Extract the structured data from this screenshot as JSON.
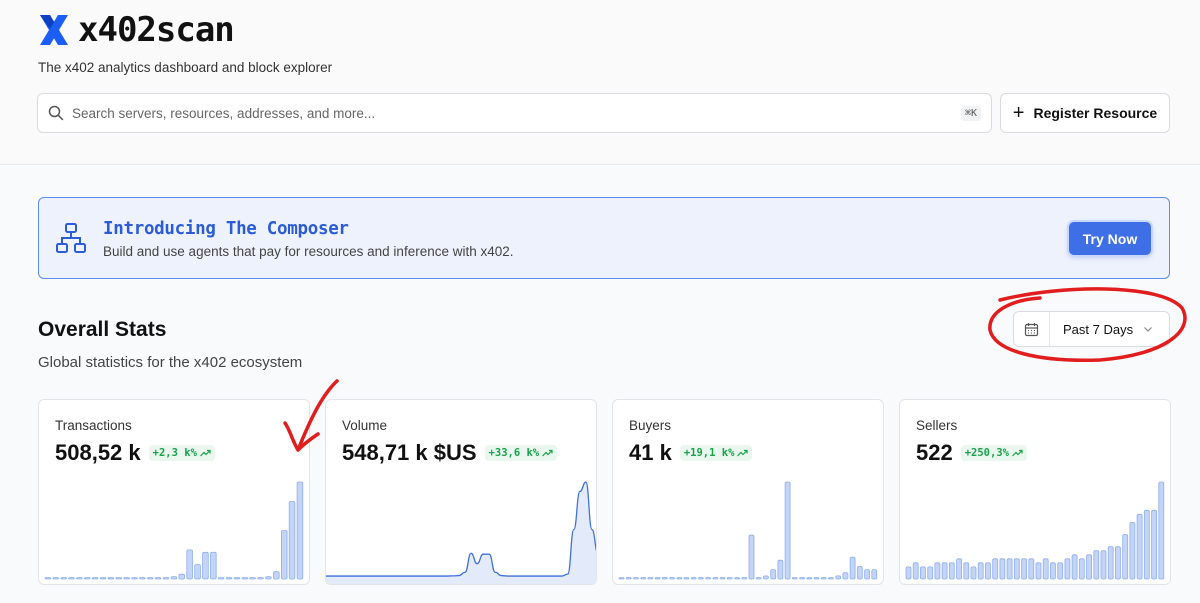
{
  "app": {
    "name": "x402scan",
    "tagline": "The x402 analytics dashboard and block explorer"
  },
  "search": {
    "placeholder": "Search servers, resources, addresses, and more...",
    "shortcut": "⌘K"
  },
  "header": {
    "register_label": "Register Resource"
  },
  "banner": {
    "title": "Introducing The Composer",
    "subtitle": "Build and use agents that pay for resources and inference with x402.",
    "cta_label": "Try Now"
  },
  "stats": {
    "title": "Overall Stats",
    "subtitle": "Global statistics for the x402 ecosystem",
    "range_label": "Past 7 Days",
    "cards": [
      {
        "title": "Transactions",
        "value": "508,52 k",
        "change": "+2,3 k%",
        "chart": "bar"
      },
      {
        "title": "Volume",
        "value": "548,71 k $US",
        "change": "+33,6 k%",
        "chart": "line"
      },
      {
        "title": "Buyers",
        "value": "41 k",
        "change": "+19,1 k%",
        "chart": "bar"
      },
      {
        "title": "Sellers",
        "value": "522",
        "change": "+250,3%",
        "chart": "bar"
      }
    ]
  },
  "chart_data": [
    {
      "type": "bar",
      "series": [
        {
          "values": [
            0,
            0,
            0,
            0,
            0,
            0,
            0,
            0,
            0,
            0,
            0,
            0,
            0,
            0,
            0,
            0,
            1,
            2,
            12,
            6,
            11,
            11,
            0,
            0,
            0,
            0,
            0,
            0,
            1,
            3,
            20,
            32,
            40
          ]
        }
      ]
    },
    {
      "type": "line",
      "series": [
        {
          "values": [
            0.1,
            0.1,
            0.1,
            0.1,
            0.1,
            0.1,
            0.1,
            0.1,
            0.1,
            0.1,
            0.1,
            0.1,
            0.1,
            0.1,
            0.1,
            0.1,
            0.1,
            0.1,
            0.1,
            0.1,
            0.1,
            0.12,
            0.15,
            0.5,
            2.5,
            1.4,
            2.4,
            2.4,
            0.5,
            0.15,
            0.1,
            0.1,
            0.1,
            0.1,
            0.1,
            0.1,
            0.1,
            0.1,
            0.1,
            0.1,
            0.3,
            5,
            9,
            10,
            5,
            2.5
          ]
        }
      ]
    },
    {
      "type": "bar",
      "series": [
        {
          "values": [
            0,
            0,
            0,
            0,
            0,
            0,
            0.5,
            0,
            0,
            0,
            0,
            0,
            0,
            0,
            0,
            0,
            0,
            0,
            14,
            0,
            1,
            3,
            6,
            31,
            0,
            0,
            0,
            0,
            0,
            0,
            1,
            2,
            7,
            4,
            3,
            3
          ]
        }
      ]
    },
    {
      "type": "bar",
      "series": [
        {
          "values": [
            3,
            4,
            3,
            3,
            4,
            4,
            4,
            5,
            4,
            3,
            4,
            4,
            5,
            5,
            5,
            5,
            5,
            5,
            4,
            5,
            4,
            4,
            5,
            6,
            5,
            6,
            7,
            7,
            8,
            8,
            11,
            14,
            16,
            17,
            17,
            24
          ]
        }
      ]
    }
  ],
  "colors": {
    "accent": "#3e6fe6",
    "positive": "#16a34a",
    "bar": "#c3d4f7",
    "line": "#3f72d8",
    "annotation": "#e11d1d"
  }
}
